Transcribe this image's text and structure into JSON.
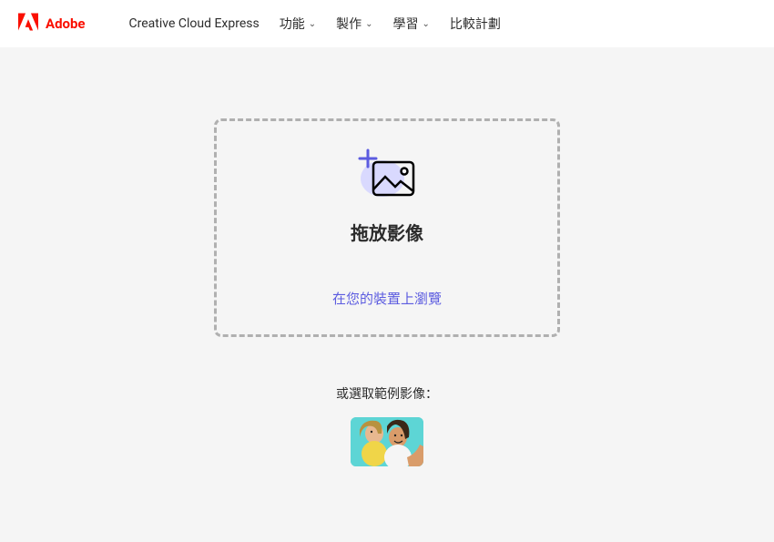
{
  "header": {
    "brand": "Adobe",
    "nav": {
      "cce": "Creative Cloud Express",
      "features": "功能",
      "create": "製作",
      "learn": "學習",
      "compare": "比較計劃"
    }
  },
  "dropzone": {
    "title": "拖放影像",
    "browse": "在您的裝置上瀏覽"
  },
  "sample": {
    "label": "或選取範例影像："
  }
}
